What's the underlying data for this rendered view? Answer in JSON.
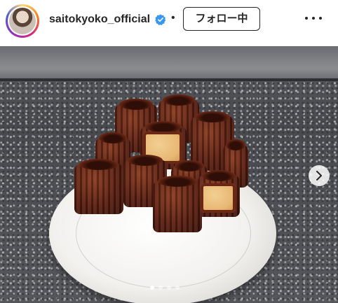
{
  "post": {
    "username": "saitokyoko_official",
    "separator": "•",
    "follow_label": "フォロー中",
    "verified_icon": "verified-badge-icon",
    "more_icon": "more-options-icon"
  },
  "carousel": {
    "slides": 4,
    "current": 1,
    "next_icon": "chevron-right-icon"
  },
  "colors": {
    "verified": "#3897f0",
    "text": "#262626"
  }
}
